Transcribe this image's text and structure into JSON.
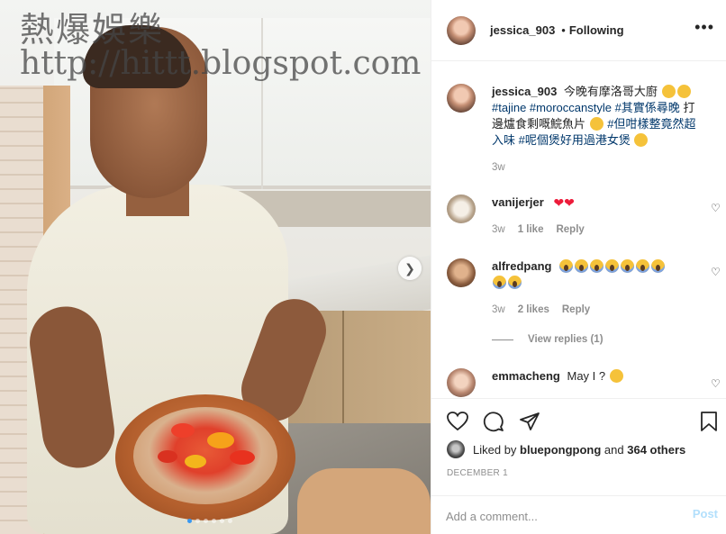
{
  "watermark": {
    "line1": "熱爆娛樂",
    "line2": "http://hittt.blogspot.com"
  },
  "header": {
    "username": "jessica_903",
    "separator": "•",
    "follow_label": "Following",
    "more": "•••"
  },
  "caption": {
    "username": "jessica_903",
    "text_part1": "今晚有摩洛哥大廚",
    "tags1": "#tajine #moroccanstyle #其實係尋晚",
    "text_part2": "打邊爐食剩嘅鯇魚片",
    "tags2": "#但咁樣整竟然超入味 #呢個煲好用過港女煲",
    "time": "3w"
  },
  "comments": [
    {
      "username": "vanijerjer",
      "text": "",
      "time": "3w",
      "likes": "1 like",
      "reply": "Reply"
    },
    {
      "username": "alfredpang",
      "text": "",
      "time": "3w",
      "likes": "2 likes",
      "reply": "Reply",
      "view_replies": "View replies (1)"
    },
    {
      "username": "emmacheng",
      "text": "May I ?"
    }
  ],
  "liked_by": {
    "prefix": "Liked by ",
    "user": "bluepongpong",
    "middle": " and ",
    "others": "364 others"
  },
  "date": "DECEMBER 1",
  "add_comment": {
    "placeholder": "Add a comment...",
    "post_label": "Post"
  },
  "carousel": {
    "dot_count": 6,
    "active_index": 0
  },
  "colors": {
    "link": "#00376b",
    "muted": "#8e8e8e",
    "post_button": "#b2dffc",
    "active_dot": "#3897f0",
    "heart": "#ed1b3a"
  },
  "icons": [
    "heart-icon",
    "comment-icon",
    "share-icon",
    "bookmark-icon",
    "chevron-right-icon",
    "more-icon"
  ]
}
